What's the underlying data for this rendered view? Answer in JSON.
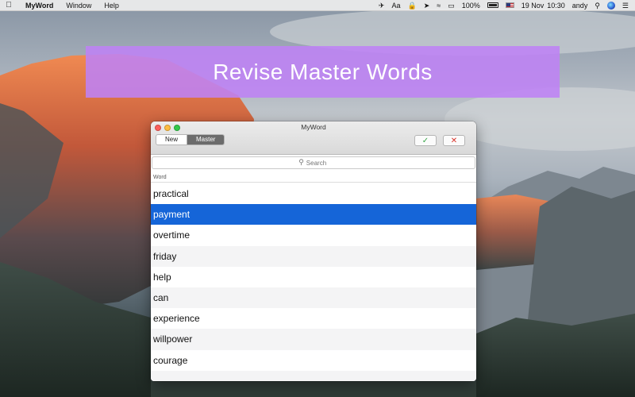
{
  "menubar": {
    "app_name": "MyWord",
    "menus": [
      "Window",
      "Help"
    ],
    "status": {
      "input_text": "Aa",
      "battery_percent": "100%",
      "date": "19 Nov",
      "time": "10:30",
      "user": "andy"
    }
  },
  "banner": {
    "title": "Revise Master Words"
  },
  "window": {
    "title": "MyWord",
    "tabs": [
      {
        "label": "New",
        "active": false
      },
      {
        "label": "Master",
        "active": true
      }
    ],
    "search_placeholder": "Search",
    "column_header": "Word",
    "words": [
      "practical",
      "payment",
      "overtime",
      "friday",
      "help",
      "can",
      "experience",
      "willpower",
      "courage"
    ],
    "selected_index": 1
  },
  "colors": {
    "banner_bg": "#be82f5",
    "selection": "#1565d8",
    "confirm": "#3aa84a",
    "cancel": "#d9342b"
  }
}
